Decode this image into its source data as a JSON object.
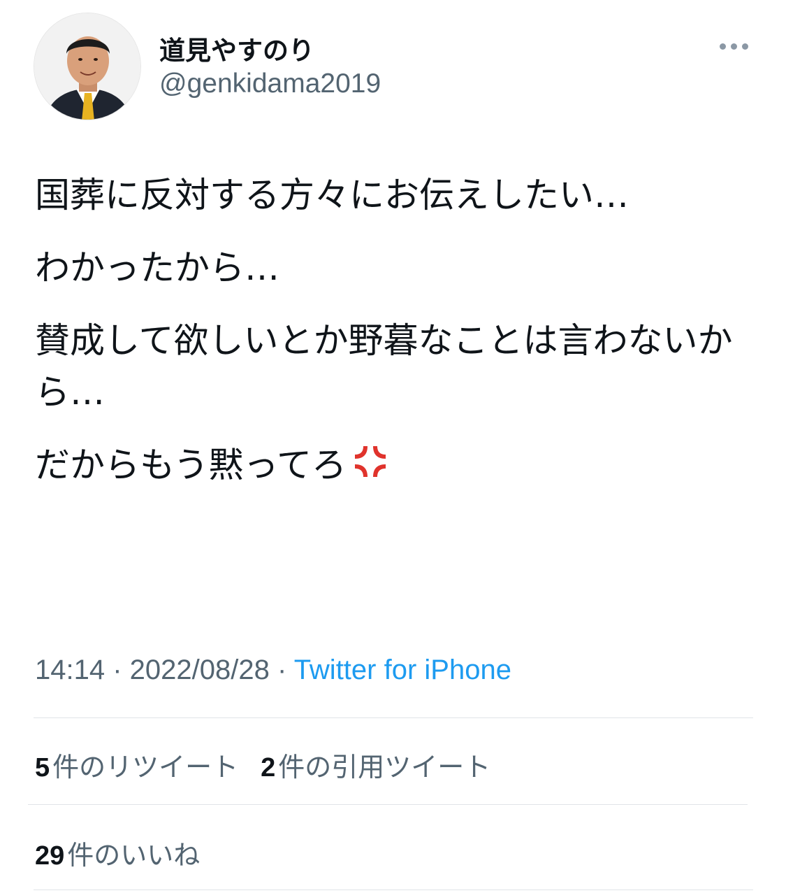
{
  "user": {
    "name": "道見やすのり",
    "handle": "@genkidama2019",
    "avatar_icon": "profile-photo"
  },
  "more_icon": "more-options-icon",
  "tweet": {
    "paragraphs": [
      "国葬に反対する方々にお伝えしたい…",
      "わかったから…",
      "賛成して欲しいとか野暮なことは言わないから…",
      "だからもう黙ってろ"
    ],
    "emoji": "anger-symbol-icon",
    "emoji_color": "#e0332c"
  },
  "meta": {
    "time": "14:14",
    "separator": " · ",
    "date": "2022/08/28",
    "source": "Twitter for iPhone",
    "source_color": "#1d9bf0"
  },
  "stats": {
    "retweets_count": "5",
    "retweets_label": "件のリツイート",
    "quotes_count": "2",
    "quotes_label": "件の引用ツイート",
    "likes_count": "29",
    "likes_label": "件のいいね"
  }
}
